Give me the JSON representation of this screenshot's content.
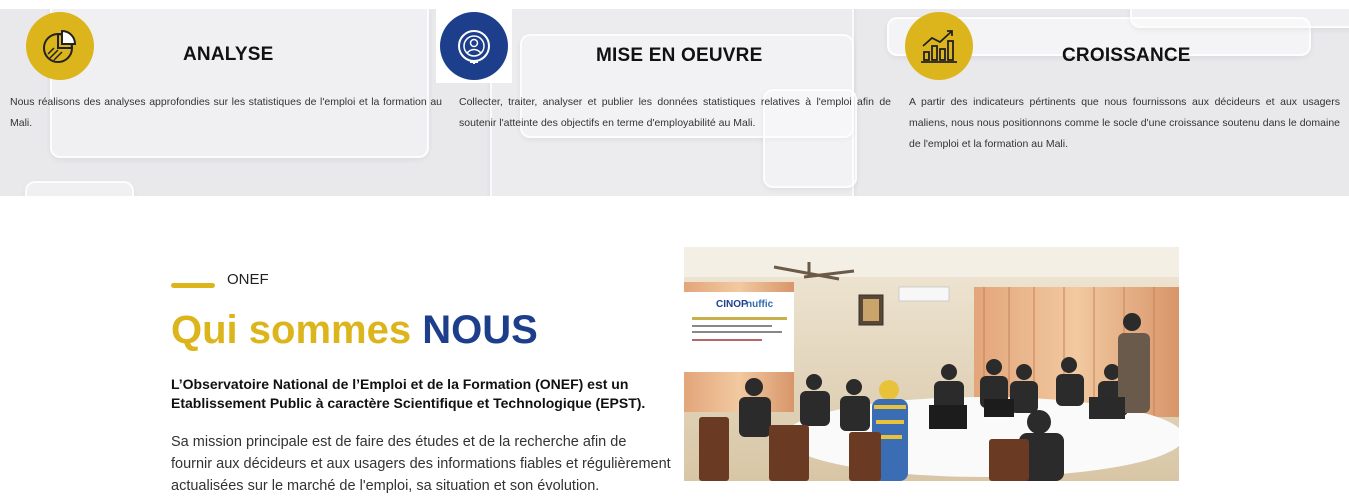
{
  "features": [
    {
      "title": "ANALYSE",
      "description": "Nous réalisons des analyses approfondies sur les statistiques de l'emploi et la formation au Mali.",
      "icon": "pie-chart-icon",
      "color": "#dcb51c"
    },
    {
      "title": "MISE EN OEUVRE",
      "description": "Collecter, traiter, analyser et publier les données statistiques relatives à l'emploi afin de soutenir l'atteinte des objectifs en terme d'employabilité au Mali.",
      "icon": "user-target-icon",
      "color": "#1d3f8b"
    },
    {
      "title": "CROISSANCE",
      "description": "A partir des indicateurs pértinents que nous fournissons aux décideurs et aux usagers maliens, nous nous positionnons comme le socle d'une croissance soutenu dans le domaine de l'emploi et la formation au Mali.",
      "icon": "growth-chart-icon",
      "color": "#dcb51c"
    }
  ],
  "about": {
    "tag": "ONEF",
    "headline_part1": "Qui sommes",
    "headline_part2": "NOUS",
    "intro_bold": "L’Observatoire National de l’Emploi et de la Formation (ONEF) est un Etablissement Public à caractère Scientifique et Technologique (EPST).",
    "intro_text": "Sa mission principale est de faire des études et de la recherche afin de fournir aux décideurs et aux usagers des informations fiables et régulièrement actualisées sur le marché de l'emploi, sa situation et son évolution."
  },
  "photo": {
    "banner_logos": [
      "CINOP",
      "nuffic"
    ]
  },
  "colors": {
    "gold": "#dcb51c",
    "navy": "#1d3f8b"
  }
}
